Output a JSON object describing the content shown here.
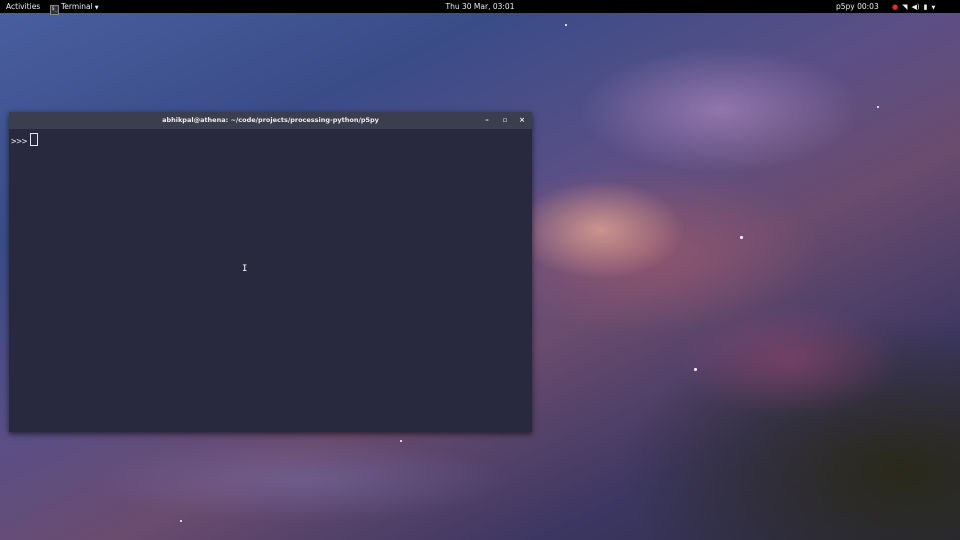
{
  "topbar": {
    "activities_label": "Activities",
    "app_menu_label": "Terminal",
    "app_icon_glyph": "$_",
    "clock": "Thu 30 Mar, 03:01",
    "recording_status": "p5py 00:03",
    "icons": [
      "record-icon",
      "wifi-icon",
      "volume-icon",
      "power-icon",
      "chevron-down-icon"
    ]
  },
  "terminal": {
    "title": "abhikpal@athena: ~/code/projects/processing-python/p5py",
    "prompt": ">>>",
    "buttons": {
      "minimize_glyph": "–",
      "maximize_glyph": "▫",
      "close_glyph": "×"
    }
  },
  "colors": {
    "topbar_bg": "#000000",
    "terminal_bg": "#28293f",
    "titlebar_bg": "#3b3e4e",
    "record_dot": "#ef2929"
  }
}
